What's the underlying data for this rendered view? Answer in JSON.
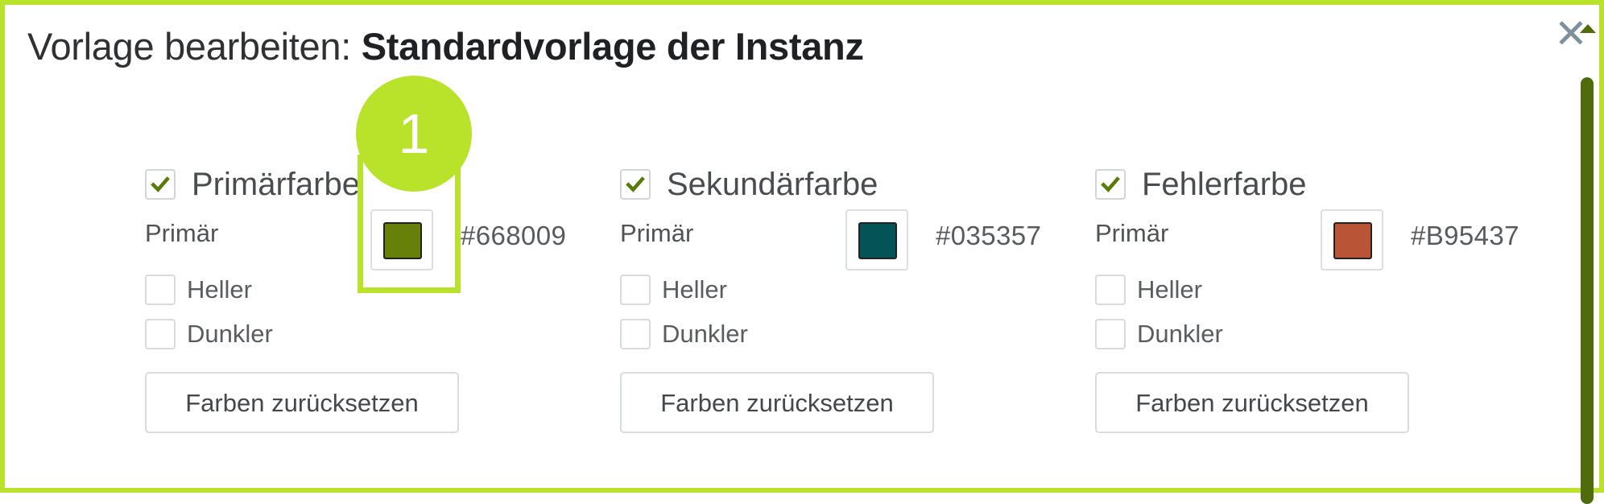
{
  "dialog": {
    "title_prefix": "Vorlage bearbeiten: ",
    "title_name": "Standardvorlage der Instanz",
    "close_glyph": "✕"
  },
  "annotation": {
    "marker_number": "1"
  },
  "groups": [
    {
      "label": "Primärfarbe",
      "checked": true,
      "row_label": "Primär",
      "color": "#668009",
      "hex": "#668009",
      "lighter_label": "Heller",
      "darker_label": "Dunkler",
      "reset_label": "Farben zurücksetzen"
    },
    {
      "label": "Sekundärfarbe",
      "checked": true,
      "row_label": "Primär",
      "color": "#035357",
      "hex": "#035357",
      "lighter_label": "Heller",
      "darker_label": "Dunkler",
      "reset_label": "Farben zurücksetzen"
    },
    {
      "label": "Fehlerfarbe",
      "checked": true,
      "row_label": "Primär",
      "color": "#B95437",
      "hex": "#B95437",
      "lighter_label": "Heller",
      "darker_label": "Dunkler",
      "reset_label": "Farben zurücksetzen"
    }
  ],
  "colors": {
    "highlight": "#b8e32a",
    "checkmark": "#5a7a0a",
    "scrollbar": "#4f6b0b"
  },
  "icons": {
    "checkmark": "check-icon",
    "close": "close-icon"
  }
}
